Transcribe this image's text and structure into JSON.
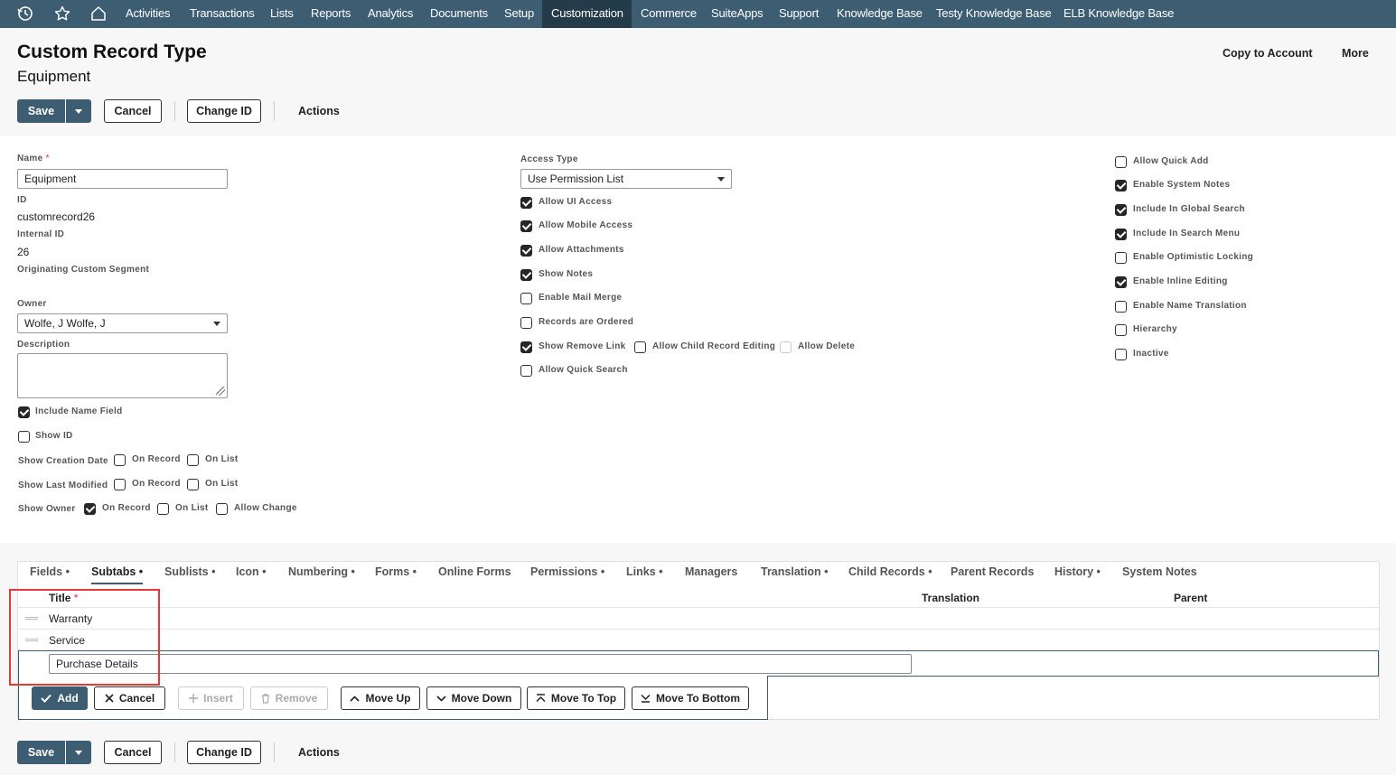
{
  "nav": {
    "icons": [
      "history-icon",
      "star-icon",
      "home-icon"
    ],
    "items": [
      "Activities",
      "Transactions",
      "Lists",
      "Reports",
      "Analytics",
      "Documents",
      "Setup",
      "Customization",
      "Commerce",
      "SuiteApps",
      "Support",
      "Knowledge Base",
      "Testy Knowledge Base",
      "ELB Knowledge Base"
    ],
    "active": "Customization"
  },
  "header": {
    "title": "Custom Record Type",
    "subtitle": "Equipment",
    "copy_to_account": "Copy to Account",
    "more": "More"
  },
  "toolbar": {
    "save": "Save",
    "cancel": "Cancel",
    "change_id": "Change ID",
    "actions": "Actions"
  },
  "form": {
    "name_label": "Name",
    "name_required": "*",
    "name_value": "Equipment",
    "id_label": "ID",
    "id_value": "customrecord26",
    "internal_id_label": "Internal ID",
    "internal_id_value": "26",
    "orig_segment_label": "Originating Custom Segment",
    "owner_label": "Owner",
    "owner_value": "Wolfe, J Wolfe, J",
    "description_label": "Description",
    "include_name_field": "Include Name Field",
    "show_id": "Show ID",
    "show_creation_date": "Show Creation Date",
    "show_last_modified": "Show Last Modified",
    "show_owner": "Show Owner",
    "on_record": "On Record",
    "on_list": "On List",
    "allow_change": "Allow Change",
    "access_type_label": "Access Type",
    "access_type_value": "Use Permission List",
    "middle_checks": [
      {
        "label": "Allow UI Access",
        "checked": true
      },
      {
        "label": "Allow Mobile Access",
        "checked": true
      },
      {
        "label": "Allow Attachments",
        "checked": true
      },
      {
        "label": "Show Notes",
        "checked": true
      },
      {
        "label": "Enable Mail Merge",
        "checked": false
      },
      {
        "label": "Records are Ordered",
        "checked": false
      },
      {
        "label": "Show Remove Link",
        "checked": true
      },
      {
        "label": "Allow Quick Search",
        "checked": false
      }
    ],
    "allow_child_record_editing": "Allow Child Record Editing",
    "allow_delete": "Allow Delete",
    "right_checks": [
      {
        "label": "Allow Quick Add",
        "checked": false
      },
      {
        "label": "Enable System Notes",
        "checked": true
      },
      {
        "label": "Include In Global Search",
        "checked": true
      },
      {
        "label": "Include In Search Menu",
        "checked": true
      },
      {
        "label": "Enable Optimistic Locking",
        "checked": false
      },
      {
        "label": "Enable Inline Editing",
        "checked": true
      },
      {
        "label": "Enable Name Translation",
        "checked": false
      },
      {
        "label": "Hierarchy",
        "checked": false
      },
      {
        "label": "Inactive",
        "checked": false
      }
    ]
  },
  "tabs": [
    "Fields •",
    "Subtabs •",
    "Sublists •",
    "Icon •",
    "Numbering •",
    "Forms •",
    "Online Forms",
    "Permissions •",
    "Links •",
    "Managers",
    "Translation •",
    "Child Records •",
    "Parent Records",
    "History •",
    "System Notes"
  ],
  "active_tab": "Subtabs •",
  "sublist": {
    "col_title": "Title",
    "col_title_req": "*",
    "col_translation": "Translation",
    "col_parent": "Parent",
    "rows": [
      "Warranty",
      "Service"
    ],
    "edit_value": "Purchase Details",
    "buttons": {
      "add": "Add",
      "cancel": "Cancel",
      "insert": "Insert",
      "remove": "Remove",
      "move_up": "Move Up",
      "move_down": "Move Down",
      "move_to_top": "Move To Top",
      "move_to_bottom": "Move To Bottom"
    }
  },
  "colors": {
    "nav": "#3c5d72",
    "nav_active": "#243b4a",
    "highlight": "#e53935"
  }
}
